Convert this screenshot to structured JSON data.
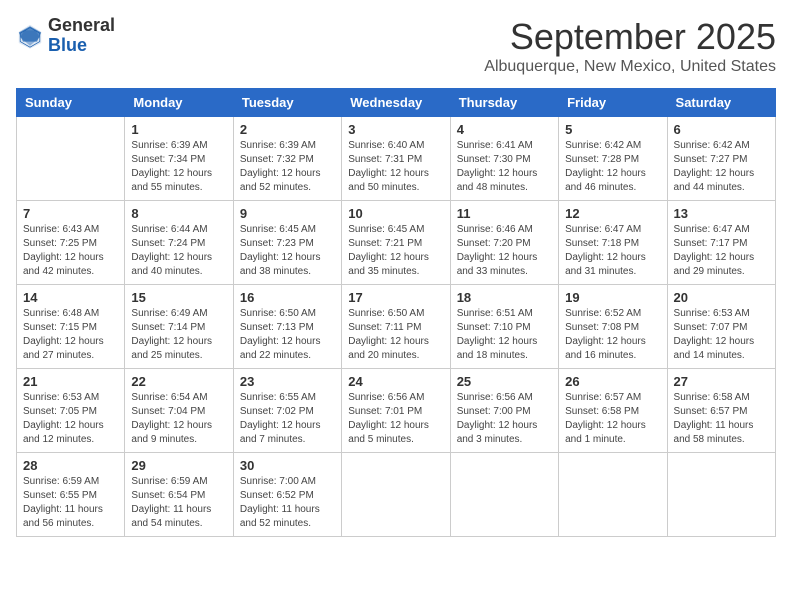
{
  "header": {
    "logo_general": "General",
    "logo_blue": "Blue",
    "month": "September 2025",
    "location": "Albuquerque, New Mexico, United States"
  },
  "weekdays": [
    "Sunday",
    "Monday",
    "Tuesday",
    "Wednesday",
    "Thursday",
    "Friday",
    "Saturday"
  ],
  "weeks": [
    [
      {
        "day": "",
        "info": ""
      },
      {
        "day": "1",
        "info": "Sunrise: 6:39 AM\nSunset: 7:34 PM\nDaylight: 12 hours\nand 55 minutes."
      },
      {
        "day": "2",
        "info": "Sunrise: 6:39 AM\nSunset: 7:32 PM\nDaylight: 12 hours\nand 52 minutes."
      },
      {
        "day": "3",
        "info": "Sunrise: 6:40 AM\nSunset: 7:31 PM\nDaylight: 12 hours\nand 50 minutes."
      },
      {
        "day": "4",
        "info": "Sunrise: 6:41 AM\nSunset: 7:30 PM\nDaylight: 12 hours\nand 48 minutes."
      },
      {
        "day": "5",
        "info": "Sunrise: 6:42 AM\nSunset: 7:28 PM\nDaylight: 12 hours\nand 46 minutes."
      },
      {
        "day": "6",
        "info": "Sunrise: 6:42 AM\nSunset: 7:27 PM\nDaylight: 12 hours\nand 44 minutes."
      }
    ],
    [
      {
        "day": "7",
        "info": "Sunrise: 6:43 AM\nSunset: 7:25 PM\nDaylight: 12 hours\nand 42 minutes."
      },
      {
        "day": "8",
        "info": "Sunrise: 6:44 AM\nSunset: 7:24 PM\nDaylight: 12 hours\nand 40 minutes."
      },
      {
        "day": "9",
        "info": "Sunrise: 6:45 AM\nSunset: 7:23 PM\nDaylight: 12 hours\nand 38 minutes."
      },
      {
        "day": "10",
        "info": "Sunrise: 6:45 AM\nSunset: 7:21 PM\nDaylight: 12 hours\nand 35 minutes."
      },
      {
        "day": "11",
        "info": "Sunrise: 6:46 AM\nSunset: 7:20 PM\nDaylight: 12 hours\nand 33 minutes."
      },
      {
        "day": "12",
        "info": "Sunrise: 6:47 AM\nSunset: 7:18 PM\nDaylight: 12 hours\nand 31 minutes."
      },
      {
        "day": "13",
        "info": "Sunrise: 6:47 AM\nSunset: 7:17 PM\nDaylight: 12 hours\nand 29 minutes."
      }
    ],
    [
      {
        "day": "14",
        "info": "Sunrise: 6:48 AM\nSunset: 7:15 PM\nDaylight: 12 hours\nand 27 minutes."
      },
      {
        "day": "15",
        "info": "Sunrise: 6:49 AM\nSunset: 7:14 PM\nDaylight: 12 hours\nand 25 minutes."
      },
      {
        "day": "16",
        "info": "Sunrise: 6:50 AM\nSunset: 7:13 PM\nDaylight: 12 hours\nand 22 minutes."
      },
      {
        "day": "17",
        "info": "Sunrise: 6:50 AM\nSunset: 7:11 PM\nDaylight: 12 hours\nand 20 minutes."
      },
      {
        "day": "18",
        "info": "Sunrise: 6:51 AM\nSunset: 7:10 PM\nDaylight: 12 hours\nand 18 minutes."
      },
      {
        "day": "19",
        "info": "Sunrise: 6:52 AM\nSunset: 7:08 PM\nDaylight: 12 hours\nand 16 minutes."
      },
      {
        "day": "20",
        "info": "Sunrise: 6:53 AM\nSunset: 7:07 PM\nDaylight: 12 hours\nand 14 minutes."
      }
    ],
    [
      {
        "day": "21",
        "info": "Sunrise: 6:53 AM\nSunset: 7:05 PM\nDaylight: 12 hours\nand 12 minutes."
      },
      {
        "day": "22",
        "info": "Sunrise: 6:54 AM\nSunset: 7:04 PM\nDaylight: 12 hours\nand 9 minutes."
      },
      {
        "day": "23",
        "info": "Sunrise: 6:55 AM\nSunset: 7:02 PM\nDaylight: 12 hours\nand 7 minutes."
      },
      {
        "day": "24",
        "info": "Sunrise: 6:56 AM\nSunset: 7:01 PM\nDaylight: 12 hours\nand 5 minutes."
      },
      {
        "day": "25",
        "info": "Sunrise: 6:56 AM\nSunset: 7:00 PM\nDaylight: 12 hours\nand 3 minutes."
      },
      {
        "day": "26",
        "info": "Sunrise: 6:57 AM\nSunset: 6:58 PM\nDaylight: 12 hours\nand 1 minute."
      },
      {
        "day": "27",
        "info": "Sunrise: 6:58 AM\nSunset: 6:57 PM\nDaylight: 11 hours\nand 58 minutes."
      }
    ],
    [
      {
        "day": "28",
        "info": "Sunrise: 6:59 AM\nSunset: 6:55 PM\nDaylight: 11 hours\nand 56 minutes."
      },
      {
        "day": "29",
        "info": "Sunrise: 6:59 AM\nSunset: 6:54 PM\nDaylight: 11 hours\nand 54 minutes."
      },
      {
        "day": "30",
        "info": "Sunrise: 7:00 AM\nSunset: 6:52 PM\nDaylight: 11 hours\nand 52 minutes."
      },
      {
        "day": "",
        "info": ""
      },
      {
        "day": "",
        "info": ""
      },
      {
        "day": "",
        "info": ""
      },
      {
        "day": "",
        "info": ""
      }
    ]
  ]
}
